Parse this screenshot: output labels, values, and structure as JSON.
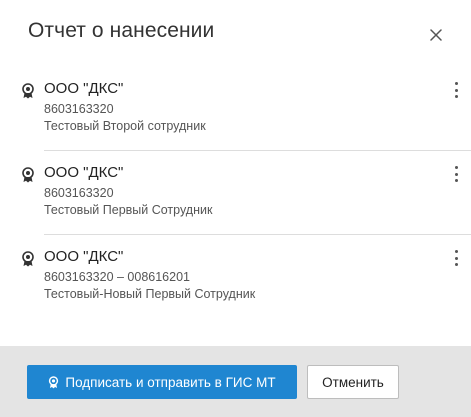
{
  "dialog": {
    "title": "Отчет о нанесении",
    "close_icon": "close-icon"
  },
  "items": [
    {
      "org": "ООО \"ДКС\"",
      "inn": "8603163320",
      "person": "Тестовый Второй сотрудник",
      "icon": "certificate-seal-icon",
      "menu_icon": "more-vertical-icon"
    },
    {
      "org": "ООО \"ДКС\"",
      "inn": "8603163320",
      "person": "Тестовый Первый Сотрудник",
      "icon": "certificate-seal-icon",
      "menu_icon": "more-vertical-icon"
    },
    {
      "org": "ООО \"ДКС\"",
      "inn": "8603163320 – 008616201",
      "person": "Тестовый-Новый Первый Сотрудник",
      "icon": "certificate-seal-icon",
      "menu_icon": "more-vertical-icon"
    }
  ],
  "footer": {
    "sign_label": "Подписать и отправить в ГИС МТ",
    "sign_icon": "certificate-seal-icon",
    "cancel_label": "Отменить"
  },
  "colors": {
    "primary": "#1f86d1",
    "footer_bg": "#e4e4e4",
    "divider": "#dddddd"
  }
}
